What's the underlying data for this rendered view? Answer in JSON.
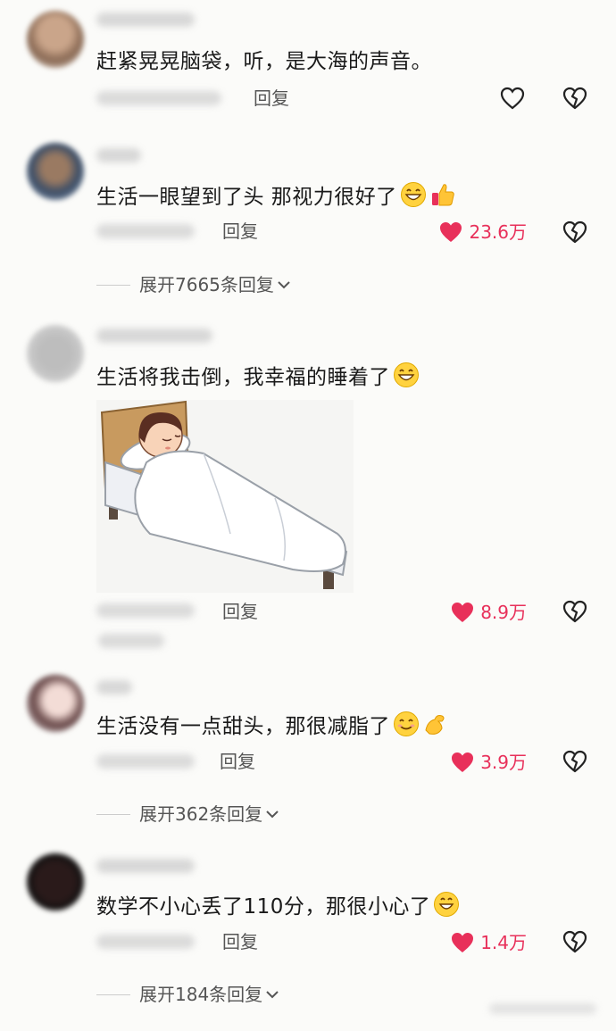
{
  "comments": [
    {
      "text": "赶紧晃晃脑袋，听，是大海的声音。",
      "reply_label": "回复",
      "likes": null
    },
    {
      "text": "生活一眼望到了头 那视力很好了",
      "emojis": [
        "grin-face",
        "thumbs-up"
      ],
      "reply_label": "回复",
      "likes": "23.6万",
      "expand_label": "展开7665条回复"
    },
    {
      "text": "生活将我击倒，我幸福的睡着了",
      "emojis": [
        "grin-face"
      ],
      "image": "sleeping-in-bed-illustration",
      "reply_label": "回复",
      "likes": "8.9万"
    },
    {
      "text": "生活没有一点甜头，那很减脂了",
      "emojis": [
        "smile-face",
        "flex-arm"
      ],
      "reply_label": "回复",
      "likes": "3.9万",
      "expand_label": "展开362条回复"
    },
    {
      "text": "数学不小心丢了110分，那很小心了",
      "emojis": [
        "grin-face"
      ],
      "reply_label": "回复",
      "likes": "1.4万",
      "expand_label": "展开184条回复"
    }
  ],
  "colors": {
    "like_red": "#e8305a",
    "text": "#1a1a1a",
    "meta_gray": "#555555"
  }
}
